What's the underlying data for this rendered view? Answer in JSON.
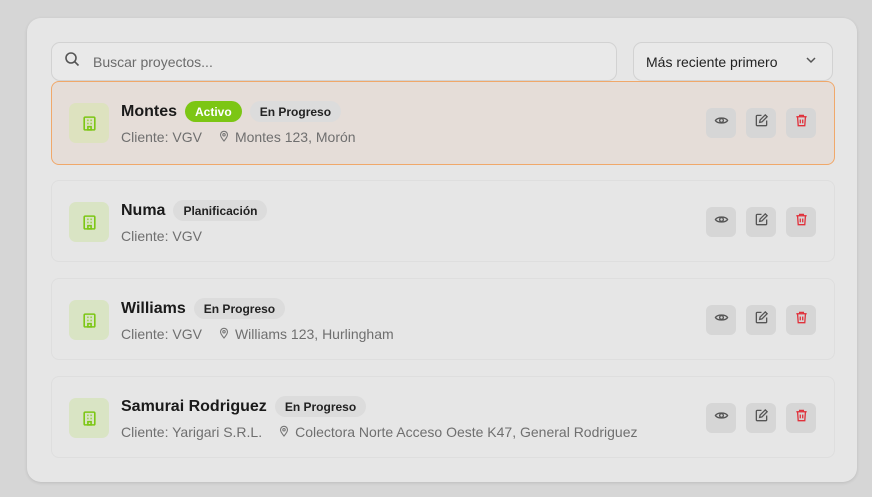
{
  "search": {
    "placeholder": "Buscar proyectos..."
  },
  "sort": {
    "selected": "Más reciente primero"
  },
  "colors": {
    "accent_green": "#7cc614",
    "active_border": "#f0a86a",
    "delete_red": "#e0313b"
  },
  "projects": [
    {
      "name": "Montes",
      "badges": [
        "Activo",
        "En Progreso"
      ],
      "client": "Cliente: VGV",
      "location": "Montes 123, Morón",
      "active": true
    },
    {
      "name": "Numa",
      "badges": [
        "Planificación"
      ],
      "client": "Cliente: VGV",
      "location": "",
      "active": false
    },
    {
      "name": "Williams",
      "badges": [
        "En Progreso"
      ],
      "client": "Cliente: VGV",
      "location": "Williams 123, Hurlingham",
      "active": false
    },
    {
      "name": "Samurai Rodriguez",
      "badges": [
        "En Progreso"
      ],
      "client": "Cliente: Yarigari S.R.L.",
      "location": "Colectora Norte Acceso Oeste K47, General Rodriguez",
      "active": false
    }
  ],
  "icons": {
    "search": "search-icon",
    "sort": "chevron-down-icon",
    "project": "building-icon",
    "location": "map-pin-icon",
    "view": "eye-icon",
    "edit": "edit-icon",
    "delete": "trash-icon"
  }
}
